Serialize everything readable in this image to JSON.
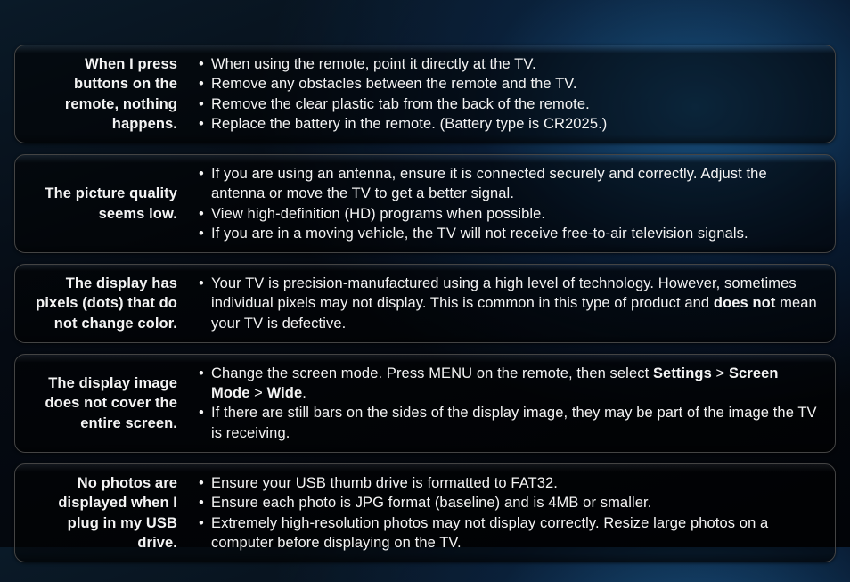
{
  "faq": [
    {
      "issue": "When I press buttons on the remote, nothing happens.",
      "items": [
        [
          {
            "t": "When using the remote, point it directly at the TV."
          }
        ],
        [
          {
            "t": "Remove any obstacles between the remote and the TV."
          }
        ],
        [
          {
            "t": "Remove the clear plastic tab from the back of the remote."
          }
        ],
        [
          {
            "t": "Replace the battery in the remote. (Battery type is CR2025.)"
          }
        ]
      ]
    },
    {
      "issue": "The picture quality seems low.",
      "items": [
        [
          {
            "t": "If you are using an antenna, ensure it is connected securely and correctly. Adjust the antenna or move the TV to get a better signal."
          }
        ],
        [
          {
            "t": "View high-definition (HD) programs when possible."
          }
        ],
        [
          {
            "t": "If you are in a moving vehicle, the TV will not receive free-to-air television signals."
          }
        ]
      ]
    },
    {
      "issue": "The display has pixels (dots) that do not change color.",
      "items": [
        [
          {
            "t": "Your TV is precision-manufactured using a high level of technology. However, sometimes individual pixels may not display. This is common in this type of product and "
          },
          {
            "t": "does not",
            "bold": true
          },
          {
            "t": " mean your TV is defective."
          }
        ]
      ]
    },
    {
      "issue": "The display image does not cover the entire screen.",
      "items": [
        [
          {
            "t": "Change the screen mode. Press MENU on the remote, then select "
          },
          {
            "t": "Settings",
            "bold": true
          },
          {
            "t": " > "
          },
          {
            "t": "Screen Mode",
            "bold": true
          },
          {
            "t": " > "
          },
          {
            "t": "Wide",
            "bold": true
          },
          {
            "t": "."
          }
        ],
        [
          {
            "t": "If there are still bars on the sides of the display image, they may be part of the image the TV is receiving."
          }
        ]
      ]
    },
    {
      "issue": "No photos are displayed when I plug in my USB drive.",
      "items": [
        [
          {
            "t": "Ensure your USB thumb drive is formatted to FAT32."
          }
        ],
        [
          {
            "t": "Ensure each photo is JPG format (baseline) and is 4MB or smaller."
          }
        ],
        [
          {
            "t": "Extremely high-resolution photos may not display correctly. Resize large photos on a computer before displaying on the TV."
          }
        ]
      ]
    }
  ]
}
